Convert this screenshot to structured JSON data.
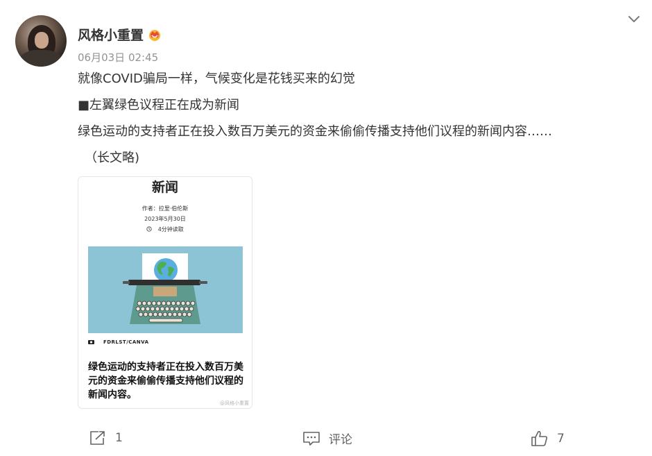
{
  "post": {
    "username": "风格小重置",
    "timestamp": "06月03日 02:45",
    "lines": [
      "就像COVID骗局一样，气候变化是花钱买来的幻觉",
      "■左翼绿色议程正在成为新闻",
      "绿色运动的支持者正在投入数百万美元的资金来偷偷传播支持他们议程的新闻内容……",
      "（长文略)"
    ]
  },
  "card": {
    "title": "新闻",
    "author": "作者：拉里·伯伦斯",
    "date": "2023年5月30日",
    "read_time": "4分钟读取",
    "credit": "FDRLST/CANVA",
    "headline": "绿色运动的支持者正在投入数百万美元的资金来偷偷传播支持他们议程的新闻内容。",
    "watermark": "@风格小重置"
  },
  "actions": {
    "share_count": "1",
    "comment_label": "评论",
    "like_count": "7"
  },
  "icons": {
    "vip": "crown-badge-icon",
    "menu": "chevron-down-icon",
    "share": "share-icon",
    "comment": "comment-icon",
    "like": "thumbs-up-icon",
    "camera": "camera-icon",
    "clock": "clock-icon"
  },
  "colors": {
    "vip_badge": "#f5a623",
    "muted_text": "#939393",
    "image_bg": "#8cc3d5"
  }
}
